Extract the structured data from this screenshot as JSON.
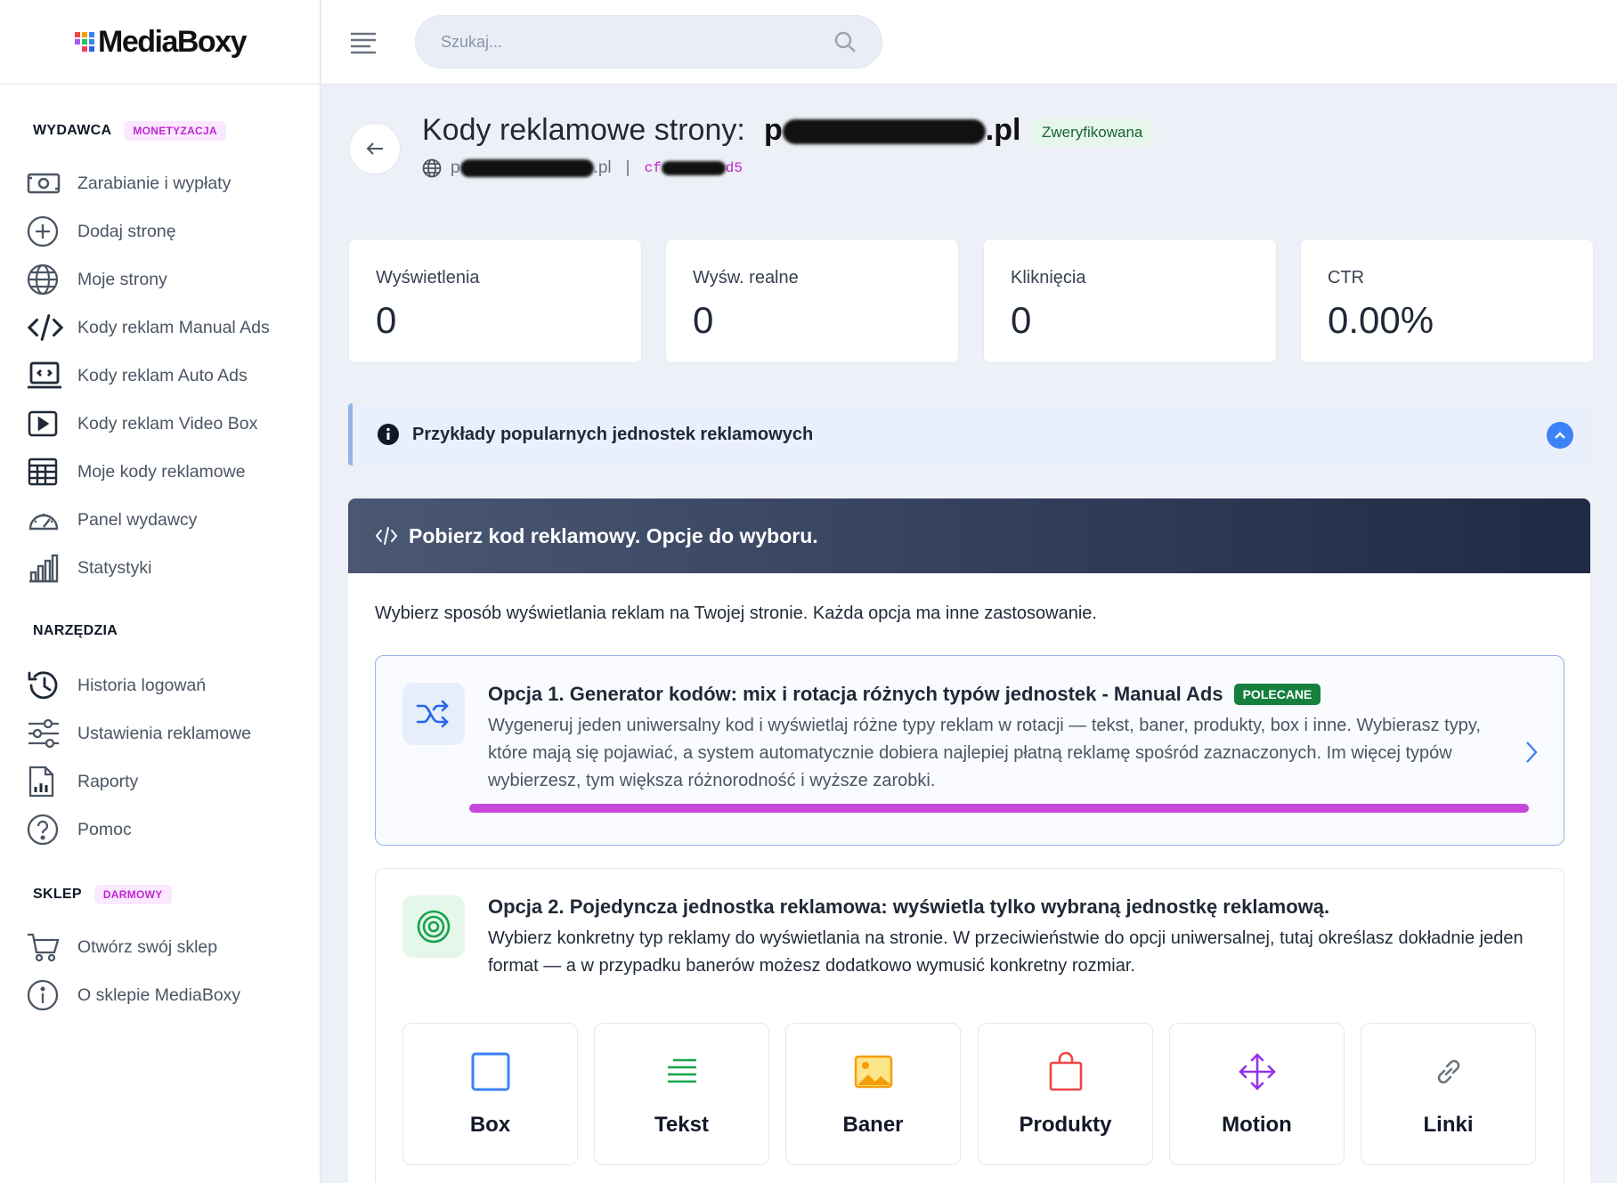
{
  "brand": {
    "name": "MediaBoxy"
  },
  "sidebar": {
    "sections": [
      {
        "title": "WYDAWCA",
        "badge": "MONETYZACJA",
        "badge_color": "#c026d3",
        "badge_bg": "#fae8ff"
      },
      {
        "title": "NARZĘDZIA"
      },
      {
        "title": "SKLEP",
        "badge": "DARMOWY",
        "badge_color": "#c026d3",
        "badge_bg": "#fae8ff"
      }
    ],
    "publisher_items": [
      {
        "label": "Zarabianie i wypłaty",
        "icon": "money-icon"
      },
      {
        "label": "Dodaj stronę",
        "icon": "plus-circle-icon"
      },
      {
        "label": "Moje strony",
        "icon": "globe-icon"
      },
      {
        "label": "Kody reklam Manual Ads",
        "icon": "code-icon"
      },
      {
        "label": "Kody reklam Auto Ads",
        "icon": "laptop-code-icon"
      },
      {
        "label": "Kody reklam Video Box",
        "icon": "video-icon"
      },
      {
        "label": "Moje kody reklamowe",
        "icon": "table-icon"
      },
      {
        "label": "Panel wydawcy",
        "icon": "gauge-icon"
      },
      {
        "label": "Statystyki",
        "icon": "bar-chart-icon"
      }
    ],
    "tools_items": [
      {
        "label": "Historia logowań",
        "icon": "history-icon"
      },
      {
        "label": "Ustawienia reklamowe",
        "icon": "sliders-icon"
      },
      {
        "label": "Raporty",
        "icon": "report-icon"
      },
      {
        "label": "Pomoc",
        "icon": "help-icon"
      }
    ],
    "shop_items": [
      {
        "label": "Otwórz swój sklep",
        "icon": "cart-icon"
      },
      {
        "label": "O sklepie MediaBoxy",
        "icon": "info-icon"
      }
    ]
  },
  "topbar": {
    "search_placeholder": "Szukaj..."
  },
  "header": {
    "title": "Kody reklamowe strony:",
    "domain_visible_prefix": "p",
    "domain_visible_suffix": ".pl",
    "status": "Zweryfikowana",
    "sub_domain_prefix": "p",
    "sub_domain_suffix": ".pl",
    "separator": "|",
    "code_prefix": "cf",
    "code_suffix": "d5"
  },
  "stats": [
    {
      "label": "Wyświetlenia",
      "value": "0"
    },
    {
      "label": "Wyśw. realne",
      "value": "0"
    },
    {
      "label": "Kliknięcia",
      "value": "0"
    },
    {
      "label": "CTR",
      "value": "0.00%"
    }
  ],
  "info_bar": {
    "label": "Przykłady popularnych jednostek reklamowych"
  },
  "panel": {
    "title": "Pobierz kod reklamowy. Opcje do wyboru.",
    "intro": "Wybierz sposób wyświetlania reklam na Twojej stronie. Każda opcja ma inne zastosowanie.",
    "option1": {
      "title": "Opcja 1. Generator kodów: mix i rotacja różnych typów jednostek - Manual Ads",
      "badge": "POLECANE",
      "description": "Wygeneruj jeden uniwersalny kod i wyświetlaj różne typy reklam w rotacji — tekst, baner, produkty, box i inne. Wybierasz typy, które mają się pojawiać, a system automatycznie dobiera najlepiej płatną reklamę spośród zaznaczonych. Im więcej typów wybierzesz, tym większa różnorodność i wyższe zarobki."
    },
    "option2": {
      "title": "Opcja 2. Pojedyncza jednostka reklamowa: wyświetla tylko wybraną jednostkę reklamową.",
      "description": "Wybierz konkretny typ reklamy do wyświetlania na stronie. W przeciwieństwie do opcji uniwersalnej, tutaj określasz dokładnie jeden format — a w przypadku banerów możesz dodatkowo wymusić konkretny rozmiar."
    },
    "formats": [
      {
        "label": "Box",
        "icon": "box-icon",
        "color": "#3b82f6"
      },
      {
        "label": "Tekst",
        "icon": "text-lines-icon",
        "color": "#16a34a"
      },
      {
        "label": "Baner",
        "icon": "image-icon",
        "color": "#f59e0b"
      },
      {
        "label": "Produkty",
        "icon": "bag-icon",
        "color": "#ef4444"
      },
      {
        "label": "Motion",
        "icon": "move-arrows-icon",
        "color": "#9333ea"
      },
      {
        "label": "Linki",
        "icon": "link-icon",
        "color": "#6b7280"
      }
    ]
  },
  "colors": {
    "accent": "#3b82f6",
    "highlight": "#c026d3",
    "success": "#15803d"
  }
}
